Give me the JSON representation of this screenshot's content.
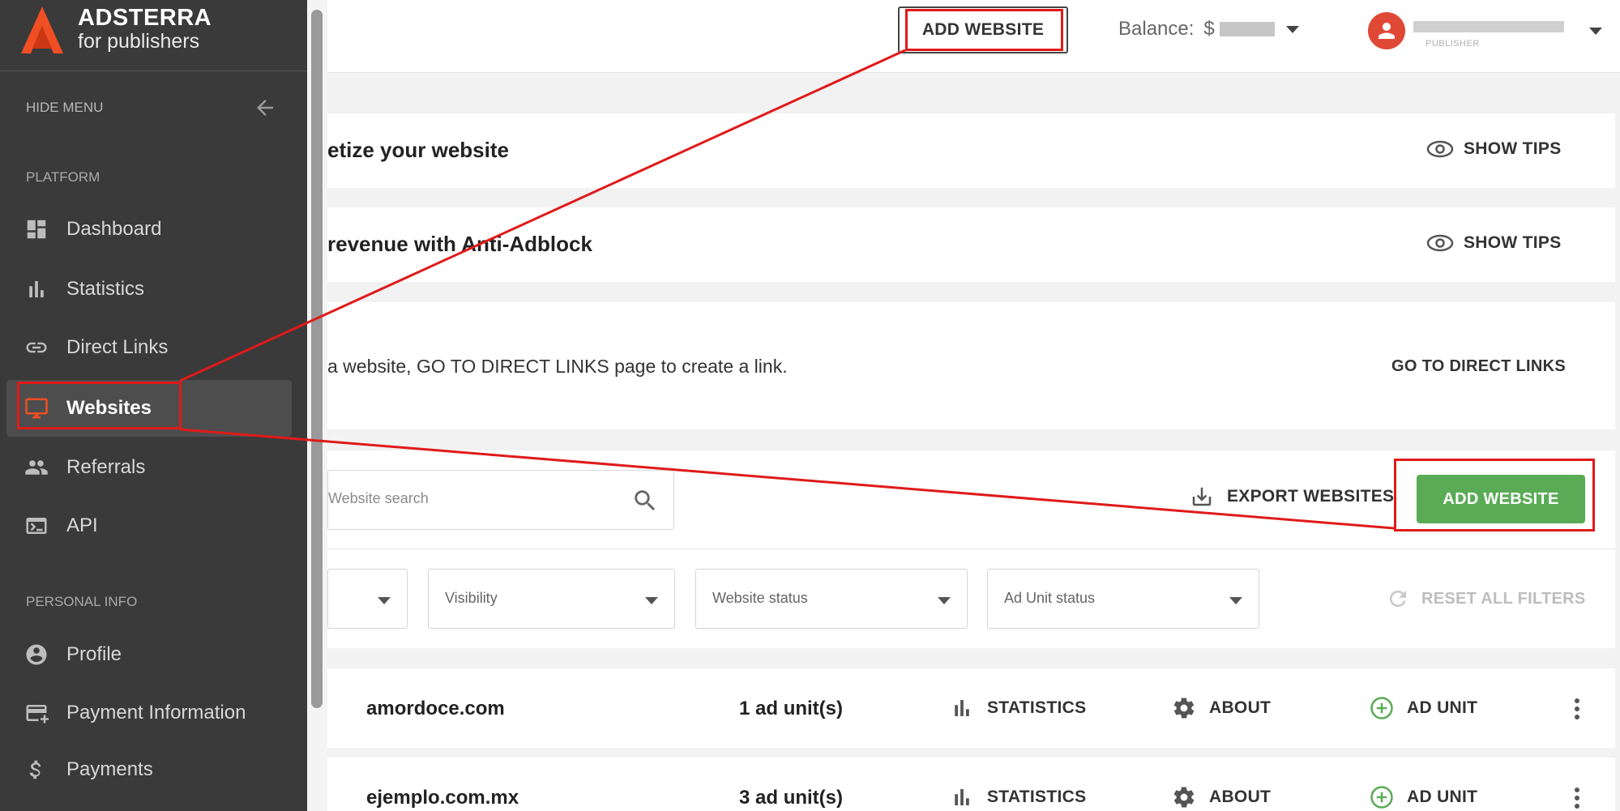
{
  "sidebar": {
    "logo_title": "ADSTERRA",
    "logo_sub": "for publishers",
    "hide_menu": "HIDE MENU",
    "section_platform": "PLATFORM",
    "section_personal": "PERSONAL INFO",
    "items": [
      {
        "label": "Dashboard",
        "icon": "dashboard-icon"
      },
      {
        "label": "Statistics",
        "icon": "bar-chart-icon"
      },
      {
        "label": "Direct Links",
        "icon": "link-icon"
      },
      {
        "label": "Websites",
        "icon": "monitor-icon",
        "active": true
      },
      {
        "label": "Referrals",
        "icon": "people-icon"
      },
      {
        "label": "API",
        "icon": "terminal-icon"
      }
    ],
    "personal_items": [
      {
        "label": "Profile",
        "icon": "account-icon"
      },
      {
        "label": "Payment Information",
        "icon": "card-icon"
      },
      {
        "label": "Payments",
        "icon": "dollar-icon"
      }
    ]
  },
  "header": {
    "add_website": "ADD WEBSITE",
    "balance_label": "Balance:",
    "currency": "$",
    "user_role": "PUBLISHER"
  },
  "cards": {
    "monetize_title": "etize your website",
    "antiadblock_title": "revenue with Anti-Adblock",
    "show_tips": "SHOW TIPS",
    "direct_text": "a website, GO TO DIRECT LINKS page to create a link.",
    "go_direct": "GO TO DIRECT LINKS"
  },
  "toolbar": {
    "search_placeholder": "Website search",
    "export": "EXPORT WEBSITES",
    "add_website": "ADD WEBSITE"
  },
  "filters": {
    "visibility": "Visibility",
    "website_status": "Website status",
    "ad_unit_status": "Ad Unit status",
    "reset": "RESET ALL FILTERS"
  },
  "websites": [
    {
      "domain": "amordoce.com",
      "units": "1 ad unit(s)",
      "statistics": "STATISTICS",
      "about": "ABOUT",
      "ad_unit": "AD UNIT"
    },
    {
      "domain": "ejemplo.com.mx",
      "units": "3 ad unit(s)",
      "statistics": "STATISTICS",
      "about": "ABOUT",
      "ad_unit": "AD UNIT"
    }
  ],
  "colors": {
    "sidebar_bg": "#3a3a3a",
    "accent_red": "#e01a1a",
    "brand_orange": "#f04e23",
    "green_button": "#5aab55"
  }
}
